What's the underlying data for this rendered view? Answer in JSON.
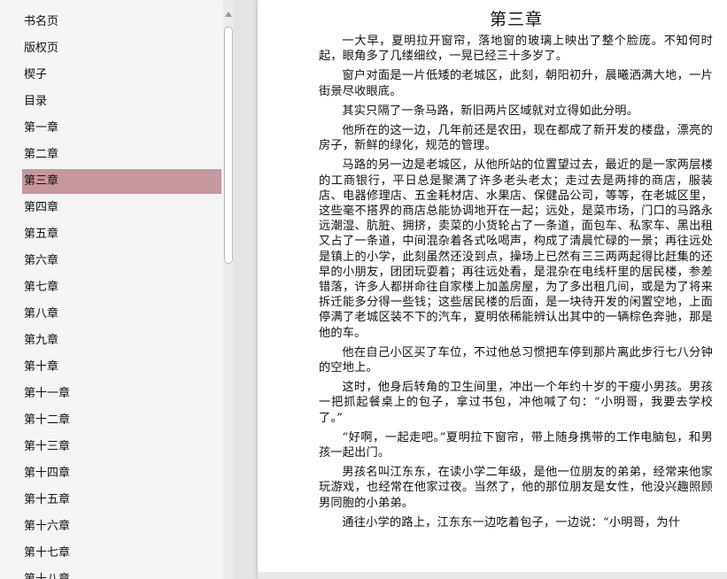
{
  "toc": {
    "items": [
      {
        "label": "书名页"
      },
      {
        "label": "版权页"
      },
      {
        "label": "楔子"
      },
      {
        "label": "目录"
      },
      {
        "label": "第一章"
      },
      {
        "label": "第二章"
      },
      {
        "label": "第三章",
        "active": true
      },
      {
        "label": "第四章"
      },
      {
        "label": "第五章"
      },
      {
        "label": "第六章"
      },
      {
        "label": "第七章"
      },
      {
        "label": "第八章"
      },
      {
        "label": "第九章"
      },
      {
        "label": "第十章"
      },
      {
        "label": "第十一章"
      },
      {
        "label": "第十二章"
      },
      {
        "label": "第十三章"
      },
      {
        "label": "第十四章"
      },
      {
        "label": "第十五章"
      },
      {
        "label": "第十六章"
      },
      {
        "label": "第十七章"
      },
      {
        "label": "第十八章"
      }
    ],
    "active_color": "#c7979f"
  },
  "page": {
    "title": "第三章",
    "paragraphs": [
      "一大早，夏明拉开窗帘，落地窗的玻璃上映出了整个脸庞。不知何时起，眼角多了几缕细纹，一晃已经三十多岁了。",
      "窗户对面是一片低矮的老城区，此刻，朝阳初升，晨曦洒满大地，一片街景尽收眼底。",
      "其实只隔了一条马路，新旧两片区域就对立得如此分明。",
      "他所在的这一边，几年前还是农田，现在都成了新开发的楼盘，漂亮的房子，新鲜的绿化，规范的管理。",
      "马路的另一边是老城区，从他所站的位置望过去，最近的是一家两层楼的工商银行，平日总是聚满了许多老头老太；走过去是两排的商店，服装店、电器修理店、五金耗材店、水果店、保健品公司，等等，在老城区里，这些毫不搭界的商店总能协调地开在一起；远处，是菜市场，门口的马路永远潮湿、肮脏、拥挤，卖菜的小货轮占了一条道，面包车、私家车、黑出租又占了一条道，中间混杂着各式吆喝声，构成了清晨忙碌的一景；再往远处是镇上的小学，此刻虽然还没到点，操场上已然有三三两两起得比赶集的还早的小朋友，团团玩耍着；再往远处看，是混杂在电线杆里的居民楼，参差错落，许多人都拼命往自家楼上加盖房屋，为了多出租几间，或是为了将来拆迁能多分得一些钱；这些居民楼的后面，是一块待开发的闲置空地，上面停满了老城区装不下的汽车，夏明依稀能辨认出其中的一辆棕色奔驰，那是他的车。",
      "他在自己小区买了车位，不过他总习惯把车停到那片离此步行七八分钟的空地上。",
      "这时，他身后转角的卫生间里，冲出一个年约十岁的干瘦小男孩。男孩一把抓起餐桌上的包子，拿过书包，冲他喊了句：“小明哥，我要去学校了。”",
      "“好啊，一起走吧。”夏明拉下窗帘，带上随身携带的工作电脑包，和男孩一起出门。",
      "男孩名叫江东东，在读小学二年级，是他一位朋友的弟弟，经常来他家玩游戏，也经常在他家过夜。当然了，他的那位朋友是女性，他没兴趣照顾男同胞的小弟弟。",
      "通往小学的路上，江东东一边吃着包子，一边说：“小明哥，为什"
    ]
  }
}
